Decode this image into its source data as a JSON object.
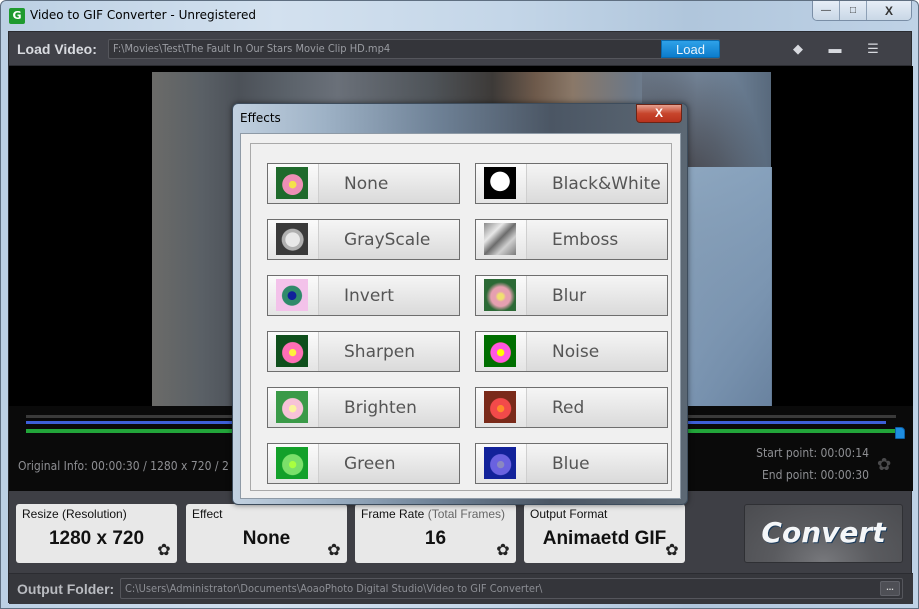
{
  "window": {
    "title": "Video to GIF Converter - Unregistered",
    "app_icon_glyph": "G",
    "controls": {
      "minimize": "—",
      "maximize": "□",
      "close": "X"
    }
  },
  "load_bar": {
    "label": "Load Video:",
    "path_value": "F:\\Movies\\Test\\The Fault In Our Stars Movie Clip HD.mp4",
    "load_button": "Load",
    "tools": [
      {
        "name": "tag-icon",
        "glyph": "◆"
      },
      {
        "name": "comment-icon",
        "glyph": "▬"
      },
      {
        "name": "register-icon",
        "glyph": "☰"
      }
    ]
  },
  "timeline": {
    "original_info": "Original Info: 00:00:30 / 1280 x 720 / 2",
    "start_point": "Start point: 00:00:14",
    "end_point": "End point: 00:00:30",
    "gear_glyph": "✿",
    "colors": {
      "range": "#3d5fd8",
      "selection": "#22a53a",
      "handle": "#1e8de0"
    }
  },
  "settings": {
    "resize": {
      "title": "Resize (Resolution)",
      "value": "1280 x 720"
    },
    "effect": {
      "title": "Effect",
      "value": "None"
    },
    "frame_rate": {
      "title": "Frame Rate",
      "title_sub": "(Total Frames)",
      "value": "16"
    },
    "output_format": {
      "title": "Output Format",
      "value": "Animaetd GIF"
    },
    "gear_glyph": "✿",
    "convert_button": "Convert"
  },
  "output": {
    "label": "Output Folder:",
    "path_value": "C:\\Users\\Administrator\\Documents\\AoaoPhoto Digital Studio\\Video to GIF Converter\\",
    "browse_button": "..."
  },
  "effects_dialog": {
    "title": "Effects",
    "close_glyph": "X",
    "effects": [
      {
        "label": "None",
        "thumb": "none"
      },
      {
        "label": "Black&White",
        "thumb": "bw"
      },
      {
        "label": "GrayScale",
        "thumb": "gray"
      },
      {
        "label": "Emboss",
        "thumb": "emboss"
      },
      {
        "label": "Invert",
        "thumb": "invert"
      },
      {
        "label": "Blur",
        "thumb": "blur"
      },
      {
        "label": "Sharpen",
        "thumb": "sharpen"
      },
      {
        "label": "Noise",
        "thumb": "noise"
      },
      {
        "label": "Brighten",
        "thumb": "brighten"
      },
      {
        "label": "Red",
        "thumb": "red"
      },
      {
        "label": "Green",
        "thumb": "green"
      },
      {
        "label": "Blue",
        "thumb": "blue"
      }
    ]
  }
}
